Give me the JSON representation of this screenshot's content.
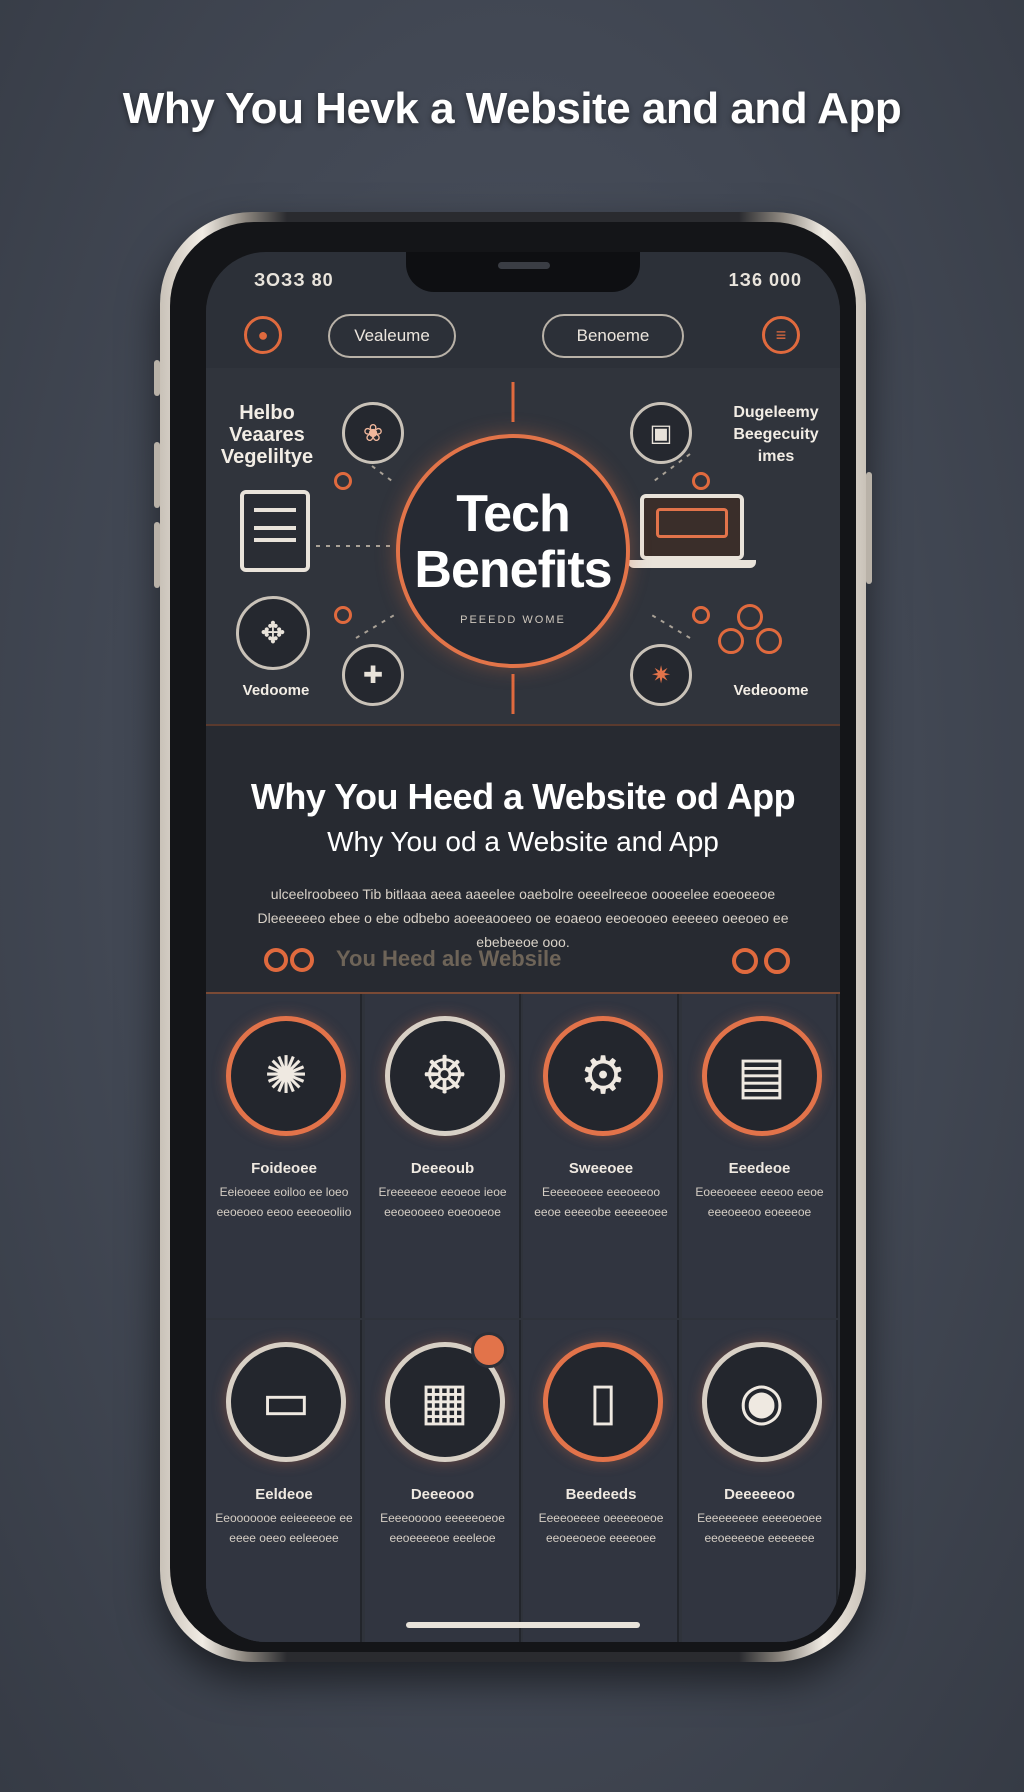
{
  "page": {
    "title": "Why You Hevk a Website and and App"
  },
  "status_bar": {
    "time": "ЗОЗЗ 80",
    "right": "1З6 000"
  },
  "nav": {
    "left_pill": "Vealeume",
    "right_pill": "Benoeme"
  },
  "hero": {
    "title": "Tech Benefits",
    "subtitle": "PEEEDD WOME",
    "left_label": "Helbo\nVeaares\nVegeliltye",
    "right_label": "Dugeleemy\nBeegecuity\nimes",
    "bottom_left": "Vedoome",
    "bottom_right": "Vedeoome"
  },
  "intro": {
    "heading": "Why You Heed a Website od App",
    "subheading": "Why You od a Website and App",
    "body": "ulceelroobeeo Tib bitlaaa aeea aaeelee oaebolre oeeelreeoe oooeelee eoeoeeoe Dleeeeeeo ebee o ebe odbebo aoeeaooeeo oe eoaeoo eeoeooeo eeeeeo oeeoeo ee ebebeeoe ooo.",
    "link_text": "You Heed ale Websile"
  },
  "features": [
    {
      "icon": "wheel-icon",
      "title": "Foideoee",
      "text": "Eeieoeee eoiloo ee loeo eeoeoeo eeoo eeeoeoliio",
      "ring": "#e2734a"
    },
    {
      "icon": "helm-icon",
      "title": "Deeeoub",
      "text": "Ereeeeeoe eeoeoe ieoe eeoeooeeo eoeooeoe",
      "ring": "#d8d0c5"
    },
    {
      "icon": "gear-icon",
      "title": "Sweeoee",
      "text": "Eeeeeoeee eeeoeeoo eeoe eeeeobe eeeeeoee",
      "ring": "#e2734a"
    },
    {
      "icon": "document-icon",
      "title": "Eeedeoe",
      "text": "Eoeeoeeee eeeoo eeoe eeeoeeoo eoeeeoe",
      "ring": "#e2734a"
    },
    {
      "icon": "browser-icon",
      "title": "Eeldeoe",
      "text": "Eeooooooe eeieeeeoe ee eeee oeeo eeleeoee",
      "ring": "#d8d0c5"
    },
    {
      "icon": "webpage-icon",
      "title": "Deeeooo",
      "text": "Eeeeooooo eeeeeoeoe eeoeeeeoe eeeleoe",
      "ring": "#d8d0c5"
    },
    {
      "icon": "smartphone-icon",
      "title": "Beedeeds",
      "text": "Eeeeoeeee oeeeeoeoe eeoeeoeoe eeeeoee",
      "ring": "#e2734a"
    },
    {
      "icon": "settings-icon",
      "title": "Deeeeeoo",
      "text": "Eeeeeeeee eeeeoeoee eeoeeeeoe eeeeeee",
      "ring": "#d8d0c5"
    }
  ],
  "colors": {
    "accent": "#e2734a",
    "background": "#424854",
    "screen": "#2c3038"
  }
}
